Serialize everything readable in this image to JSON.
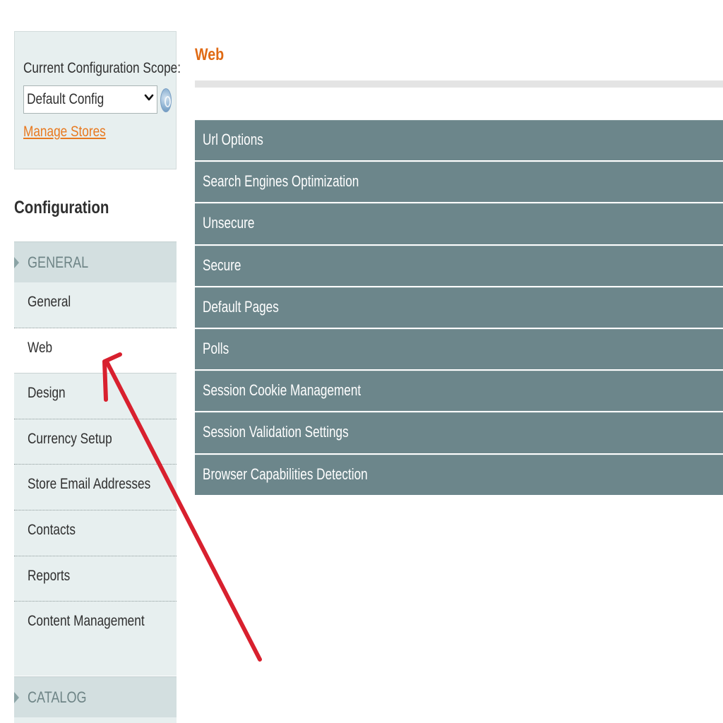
{
  "scope": {
    "label": "Current Configuration Scope:",
    "selected": "Default Config",
    "manage_link": "Manage Stores"
  },
  "sidebar": {
    "title": "Configuration",
    "groups": [
      {
        "label": "GENERAL"
      },
      {
        "label": "CATALOG"
      }
    ],
    "items": [
      {
        "label": "General"
      },
      {
        "label": "Web",
        "active": true
      },
      {
        "label": "Design"
      },
      {
        "label": "Currency Setup"
      },
      {
        "label": "Store Email Addresses"
      },
      {
        "label": "Contacts"
      },
      {
        "label": "Reports"
      },
      {
        "label": "Content Management"
      }
    ]
  },
  "main": {
    "title": "Web",
    "sections": [
      {
        "label": "Url Options"
      },
      {
        "label": "Search Engines Optimization"
      },
      {
        "label": "Unsecure"
      },
      {
        "label": "Secure"
      },
      {
        "label": "Default Pages"
      },
      {
        "label": "Polls"
      },
      {
        "label": "Session Cookie Management"
      },
      {
        "label": "Session Validation Settings"
      },
      {
        "label": "Browser Capabilities Detection"
      }
    ]
  },
  "colors": {
    "accent_orange": "#e06a14",
    "section_bar": "#6c868b",
    "sidebar_bg": "#e7efef",
    "annotation_red": "#d8202e"
  }
}
